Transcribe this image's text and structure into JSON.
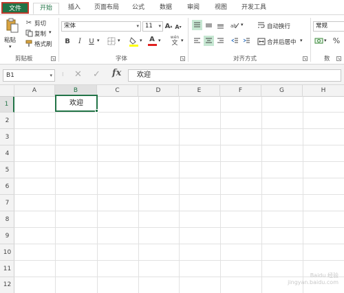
{
  "tabs": {
    "file": "文件",
    "home": "开始",
    "insert": "插入",
    "page_layout": "页面布局",
    "formulas": "公式",
    "data": "数据",
    "review": "审阅",
    "view": "视图",
    "developer": "开发工具"
  },
  "ribbon": {
    "clipboard": {
      "paste": "粘贴",
      "cut": "剪切",
      "copy": "复制",
      "format_painter": "格式刷",
      "group_label": "剪贴板"
    },
    "font": {
      "font_name": "宋体",
      "font_size": "11",
      "grow": "A",
      "shrink": "A",
      "bold": "B",
      "italic": "I",
      "underline": "U",
      "font_color_letter": "A",
      "phonetic": "wén",
      "group_label": "字体"
    },
    "alignment": {
      "wrap_text": "自动换行",
      "merge_center": "合并后居中",
      "group_label": "对齐方式"
    },
    "number": {
      "format": "常规",
      "percent": "%",
      "group_label": "数"
    }
  },
  "formula_bar": {
    "name_box": "B1",
    "cancel": "✕",
    "enter": "✓",
    "fx": "fx",
    "content": "欢迎"
  },
  "columns": [
    "A",
    "B",
    "C",
    "D",
    "E",
    "F",
    "G",
    "H"
  ],
  "rows": [
    "1",
    "2",
    "3",
    "4",
    "5",
    "6",
    "7",
    "8",
    "9",
    "10",
    "11",
    "12"
  ],
  "cells": {
    "B1": "欢迎"
  },
  "watermark": {
    "line1": "Baidu 经验",
    "line2": "jingyan.baidu.com"
  }
}
